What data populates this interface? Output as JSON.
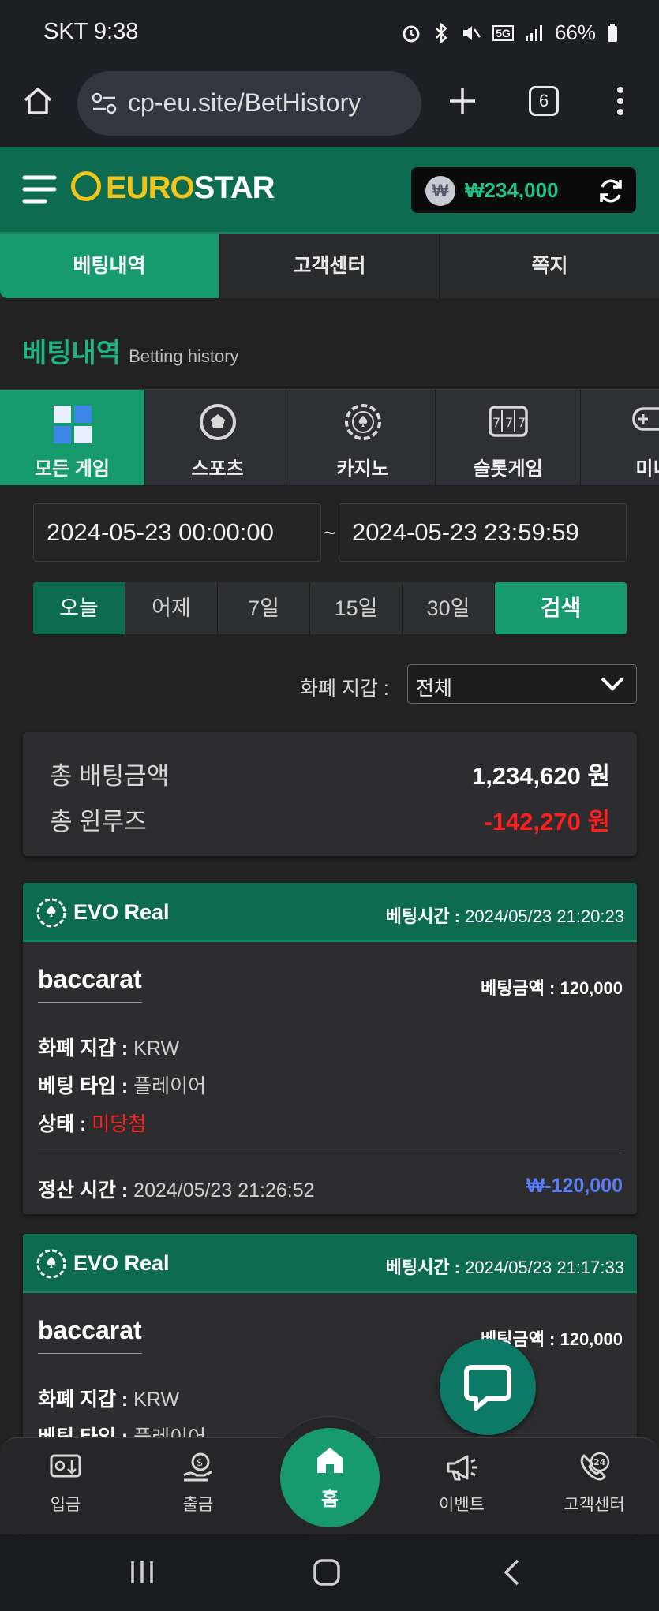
{
  "status_bar": {
    "carrier_time": "SKT 9:38",
    "battery": "66%",
    "network": "5G"
  },
  "browser": {
    "url": "cp-eu.site/BetHistory",
    "tab_count": "6"
  },
  "header": {
    "logo_euro": "EURO",
    "logo_star": "STAR",
    "currency_symbol": "₩",
    "balance": "₩234,000"
  },
  "top_tabs": [
    {
      "label": "베팅내역",
      "active": true
    },
    {
      "label": "고객센터",
      "active": false
    },
    {
      "label": "쪽지",
      "active": false
    }
  ],
  "page_title": {
    "ko": "베팅내역",
    "en": "Betting history"
  },
  "game_tabs": [
    {
      "label": "모든 게임",
      "icon": "grid-cubes-icon",
      "active": true
    },
    {
      "label": "스포츠",
      "icon": "soccer-ball-icon",
      "active": false
    },
    {
      "label": "카지노",
      "icon": "casino-chip-icon",
      "active": false
    },
    {
      "label": "슬롯게임",
      "icon": "slot-machine-icon",
      "active": false
    },
    {
      "label": "미니",
      "icon": "gamepad-icon",
      "active": false
    }
  ],
  "date_range": {
    "start": "2024-05-23 00:00:00",
    "separator": "~",
    "end": "2024-05-23 23:59:59"
  },
  "quick_ranges": [
    {
      "label": "오늘",
      "active": true
    },
    {
      "label": "어제",
      "active": false
    },
    {
      "label": "7일",
      "active": false
    },
    {
      "label": "15일",
      "active": false
    },
    {
      "label": "30일",
      "active": false
    }
  ],
  "search_label": "검색",
  "currency_filter": {
    "label": "화폐 지갑 :",
    "value": "전체"
  },
  "summary": {
    "total_bet_label": "총 배팅금액",
    "total_bet_value": "1,234,620 원",
    "total_winloss_label": "총 윈루즈",
    "total_winloss_value": "-142,270 원"
  },
  "bets": [
    {
      "provider": "EVO Real",
      "bet_time_label": "베팅시간 :",
      "bet_time": "2024/05/23 21:20:23",
      "game": "baccarat",
      "bet_amount_label": "베팅금액 :",
      "bet_amount": "120,000",
      "currency_label": "화폐 지갑 :",
      "currency": "KRW",
      "bet_type_label": "베팅 타입 :",
      "bet_type": "플레이어",
      "status_label": "상태 :",
      "status": "미당첨",
      "settle_label": "정산 시간 :",
      "settle_time": "2024/05/23 21:26:52",
      "settle_amount": "₩-120,000"
    },
    {
      "provider": "EVO Real",
      "bet_time_label": "베팅시간 :",
      "bet_time": "2024/05/23 21:17:33",
      "game": "baccarat",
      "bet_amount_label": "베팅금액 :",
      "bet_amount": "120,000",
      "currency_label": "화폐 지갑 :",
      "currency": "KRW",
      "bet_type_label": "베팅 타입 :",
      "bet_type": "플레이어"
    }
  ],
  "bottom_nav": [
    {
      "label": "입금",
      "icon": "deposit-icon"
    },
    {
      "label": "출금",
      "icon": "withdraw-icon"
    },
    {
      "label": "홈",
      "icon": "home-icon"
    },
    {
      "label": "이벤트",
      "icon": "megaphone-icon"
    },
    {
      "label": "고객센터",
      "icon": "support-24-icon"
    }
  ],
  "colors": {
    "brand_green": "#179a6e",
    "header_green": "#0d6b4f",
    "accent_yellow": "#f0c419",
    "loss_red": "#ff1f1f",
    "settle_blue": "#5b7df5"
  }
}
